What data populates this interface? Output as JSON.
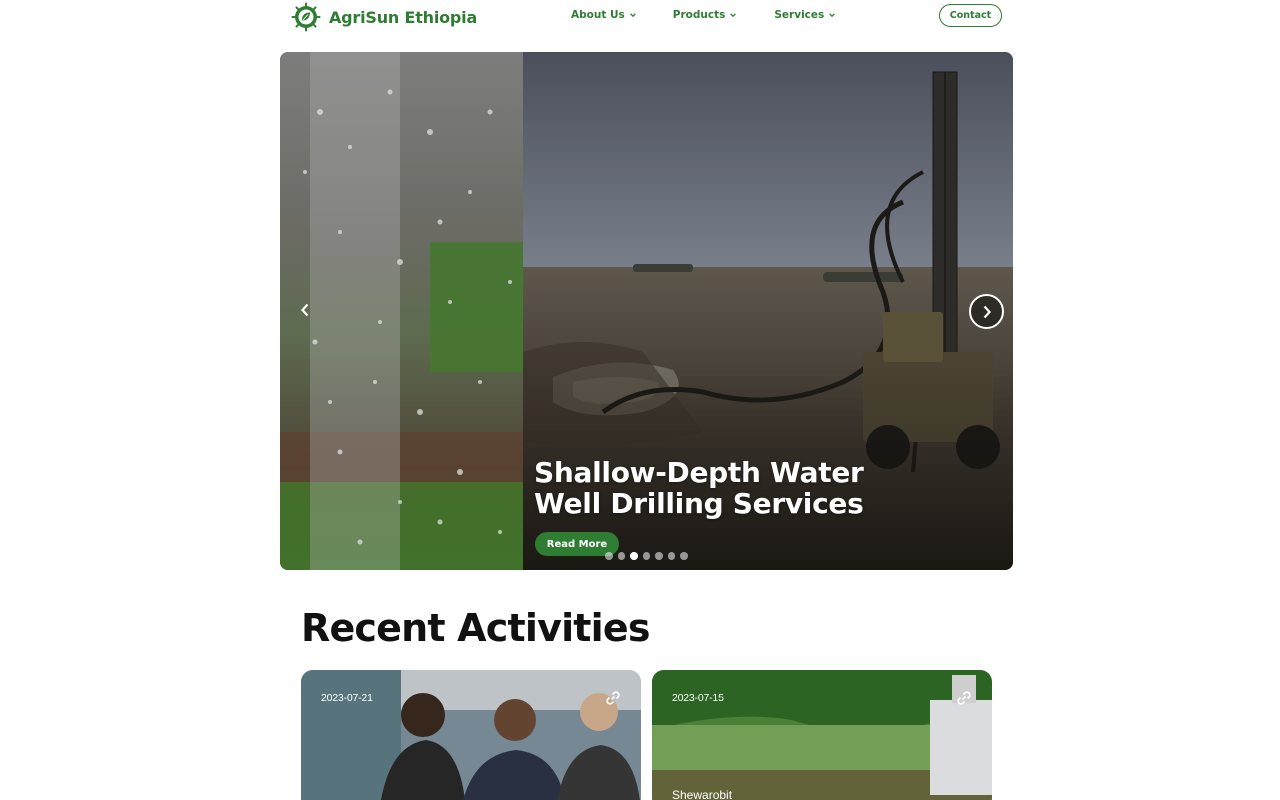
{
  "header": {
    "logo_text": "AgriSun Ethiopia",
    "nav": [
      {
        "label": "About Us"
      },
      {
        "label": "Products"
      },
      {
        "label": "Services"
      }
    ],
    "contact_label": "Contact"
  },
  "hero": {
    "title_line1": "Shallow-Depth Water",
    "title_line2": "Well Drilling Services",
    "button_label": "Read More",
    "slide_count": 7,
    "active_slide": 3
  },
  "recent": {
    "title": "Recent Activities",
    "cards": [
      {
        "date": "2023-07-21",
        "caption": ""
      },
      {
        "date": "2023-07-15",
        "caption": "Shewarobit"
      }
    ]
  },
  "colors": {
    "brand_green": "#2e7d32",
    "text_dark": "#111111"
  },
  "icons": [
    "logo-icon",
    "chevron-down-icon",
    "chevron-left-icon",
    "chevron-right-icon",
    "link-icon"
  ]
}
